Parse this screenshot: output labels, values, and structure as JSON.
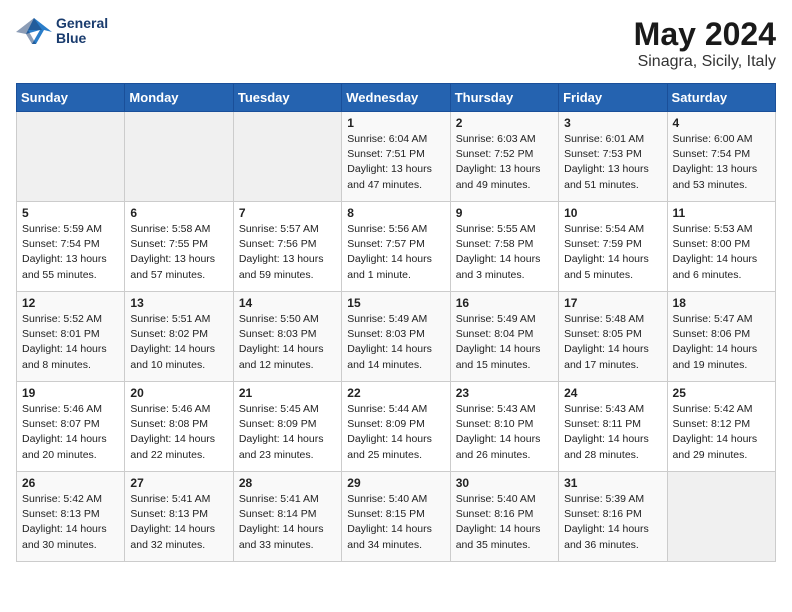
{
  "header": {
    "logo_line1": "General",
    "logo_line2": "Blue",
    "title": "May 2024",
    "subtitle": "Sinagra, Sicily, Italy"
  },
  "days_of_week": [
    "Sunday",
    "Monday",
    "Tuesday",
    "Wednesday",
    "Thursday",
    "Friday",
    "Saturday"
  ],
  "weeks": [
    [
      {
        "day": "",
        "info": ""
      },
      {
        "day": "",
        "info": ""
      },
      {
        "day": "",
        "info": ""
      },
      {
        "day": "1",
        "info": "Sunrise: 6:04 AM\nSunset: 7:51 PM\nDaylight: 13 hours\nand 47 minutes."
      },
      {
        "day": "2",
        "info": "Sunrise: 6:03 AM\nSunset: 7:52 PM\nDaylight: 13 hours\nand 49 minutes."
      },
      {
        "day": "3",
        "info": "Sunrise: 6:01 AM\nSunset: 7:53 PM\nDaylight: 13 hours\nand 51 minutes."
      },
      {
        "day": "4",
        "info": "Sunrise: 6:00 AM\nSunset: 7:54 PM\nDaylight: 13 hours\nand 53 minutes."
      }
    ],
    [
      {
        "day": "5",
        "info": "Sunrise: 5:59 AM\nSunset: 7:54 PM\nDaylight: 13 hours\nand 55 minutes."
      },
      {
        "day": "6",
        "info": "Sunrise: 5:58 AM\nSunset: 7:55 PM\nDaylight: 13 hours\nand 57 minutes."
      },
      {
        "day": "7",
        "info": "Sunrise: 5:57 AM\nSunset: 7:56 PM\nDaylight: 13 hours\nand 59 minutes."
      },
      {
        "day": "8",
        "info": "Sunrise: 5:56 AM\nSunset: 7:57 PM\nDaylight: 14 hours\nand 1 minute."
      },
      {
        "day": "9",
        "info": "Sunrise: 5:55 AM\nSunset: 7:58 PM\nDaylight: 14 hours\nand 3 minutes."
      },
      {
        "day": "10",
        "info": "Sunrise: 5:54 AM\nSunset: 7:59 PM\nDaylight: 14 hours\nand 5 minutes."
      },
      {
        "day": "11",
        "info": "Sunrise: 5:53 AM\nSunset: 8:00 PM\nDaylight: 14 hours\nand 6 minutes."
      }
    ],
    [
      {
        "day": "12",
        "info": "Sunrise: 5:52 AM\nSunset: 8:01 PM\nDaylight: 14 hours\nand 8 minutes."
      },
      {
        "day": "13",
        "info": "Sunrise: 5:51 AM\nSunset: 8:02 PM\nDaylight: 14 hours\nand 10 minutes."
      },
      {
        "day": "14",
        "info": "Sunrise: 5:50 AM\nSunset: 8:03 PM\nDaylight: 14 hours\nand 12 minutes."
      },
      {
        "day": "15",
        "info": "Sunrise: 5:49 AM\nSunset: 8:03 PM\nDaylight: 14 hours\nand 14 minutes."
      },
      {
        "day": "16",
        "info": "Sunrise: 5:49 AM\nSunset: 8:04 PM\nDaylight: 14 hours\nand 15 minutes."
      },
      {
        "day": "17",
        "info": "Sunrise: 5:48 AM\nSunset: 8:05 PM\nDaylight: 14 hours\nand 17 minutes."
      },
      {
        "day": "18",
        "info": "Sunrise: 5:47 AM\nSunset: 8:06 PM\nDaylight: 14 hours\nand 19 minutes."
      }
    ],
    [
      {
        "day": "19",
        "info": "Sunrise: 5:46 AM\nSunset: 8:07 PM\nDaylight: 14 hours\nand 20 minutes."
      },
      {
        "day": "20",
        "info": "Sunrise: 5:46 AM\nSunset: 8:08 PM\nDaylight: 14 hours\nand 22 minutes."
      },
      {
        "day": "21",
        "info": "Sunrise: 5:45 AM\nSunset: 8:09 PM\nDaylight: 14 hours\nand 23 minutes."
      },
      {
        "day": "22",
        "info": "Sunrise: 5:44 AM\nSunset: 8:09 PM\nDaylight: 14 hours\nand 25 minutes."
      },
      {
        "day": "23",
        "info": "Sunrise: 5:43 AM\nSunset: 8:10 PM\nDaylight: 14 hours\nand 26 minutes."
      },
      {
        "day": "24",
        "info": "Sunrise: 5:43 AM\nSunset: 8:11 PM\nDaylight: 14 hours\nand 28 minutes."
      },
      {
        "day": "25",
        "info": "Sunrise: 5:42 AM\nSunset: 8:12 PM\nDaylight: 14 hours\nand 29 minutes."
      }
    ],
    [
      {
        "day": "26",
        "info": "Sunrise: 5:42 AM\nSunset: 8:13 PM\nDaylight: 14 hours\nand 30 minutes."
      },
      {
        "day": "27",
        "info": "Sunrise: 5:41 AM\nSunset: 8:13 PM\nDaylight: 14 hours\nand 32 minutes."
      },
      {
        "day": "28",
        "info": "Sunrise: 5:41 AM\nSunset: 8:14 PM\nDaylight: 14 hours\nand 33 minutes."
      },
      {
        "day": "29",
        "info": "Sunrise: 5:40 AM\nSunset: 8:15 PM\nDaylight: 14 hours\nand 34 minutes."
      },
      {
        "day": "30",
        "info": "Sunrise: 5:40 AM\nSunset: 8:16 PM\nDaylight: 14 hours\nand 35 minutes."
      },
      {
        "day": "31",
        "info": "Sunrise: 5:39 AM\nSunset: 8:16 PM\nDaylight: 14 hours\nand 36 minutes."
      },
      {
        "day": "",
        "info": ""
      }
    ]
  ]
}
